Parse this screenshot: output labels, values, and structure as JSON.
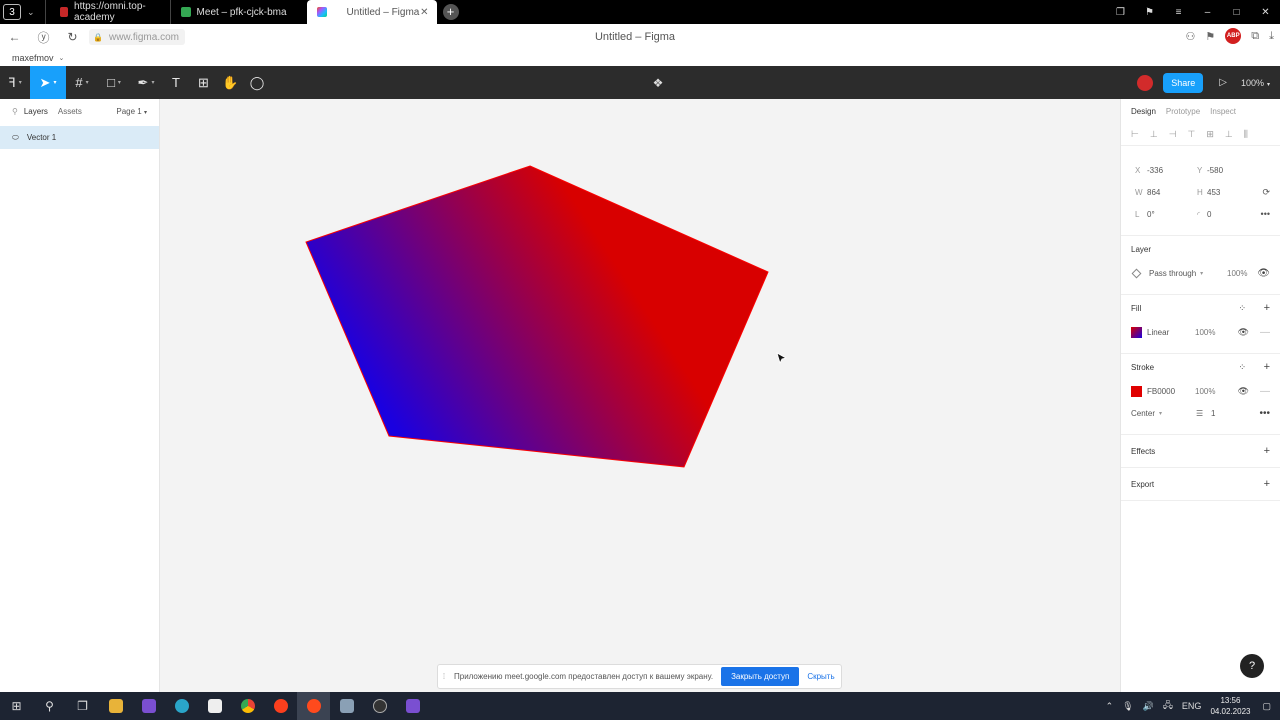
{
  "browser": {
    "tab_count": "3",
    "tabs": [
      {
        "title": "https://omni.top-academy",
        "color": "#c62828"
      },
      {
        "title": "Meet – pfk-cjck-bma",
        "color": "#34a853"
      },
      {
        "title": "Untitled – Figma",
        "color": "#f24e1e"
      }
    ],
    "url": "www.figma.com",
    "page_title": "Untitled – Figma",
    "abp_label": "ABP",
    "profile": "maxefmov"
  },
  "toolbar": {
    "share_label": "Share",
    "zoom_label": "100%"
  },
  "left_panel": {
    "tabs": [
      "Layers",
      "Assets"
    ],
    "page_label": "Page 1",
    "layers": [
      {
        "name": "Vector 1"
      }
    ]
  },
  "right_panel": {
    "tabs": [
      "Design",
      "Prototype",
      "Inspect"
    ],
    "x_label": "X",
    "x_value": "-336",
    "y_label": "Y",
    "y_value": "-580",
    "w_label": "W",
    "w_value": "864",
    "h_label": "H",
    "h_value": "453",
    "rotation_label": "L",
    "rotation_value": "0°",
    "radius_value": "0",
    "layer_title": "Layer",
    "blend_mode": "Pass through",
    "layer_opacity": "100%",
    "fill_title": "Fill",
    "fill_type": "Linear",
    "fill_opacity": "100%",
    "stroke_title": "Stroke",
    "stroke_color": "FB0000",
    "stroke_opacity": "100%",
    "stroke_align": "Center",
    "stroke_weight": "1",
    "effects_title": "Effects",
    "export_title": "Export"
  },
  "canvas": {
    "shape": "pentagon",
    "gradient_start": "#1a00e0",
    "gradient_end": "#d80000",
    "stroke_hex": "#fb0000"
  },
  "notice": {
    "message": "Приложению meet.google.com предоставлен доступ к вашему экрану.",
    "stop_button": "Закрыть доступ",
    "hide_button": "Скрыть"
  },
  "taskbar": {
    "language": "ENG",
    "time": "13:56",
    "date": "04.02.2023"
  },
  "help_label": "?"
}
